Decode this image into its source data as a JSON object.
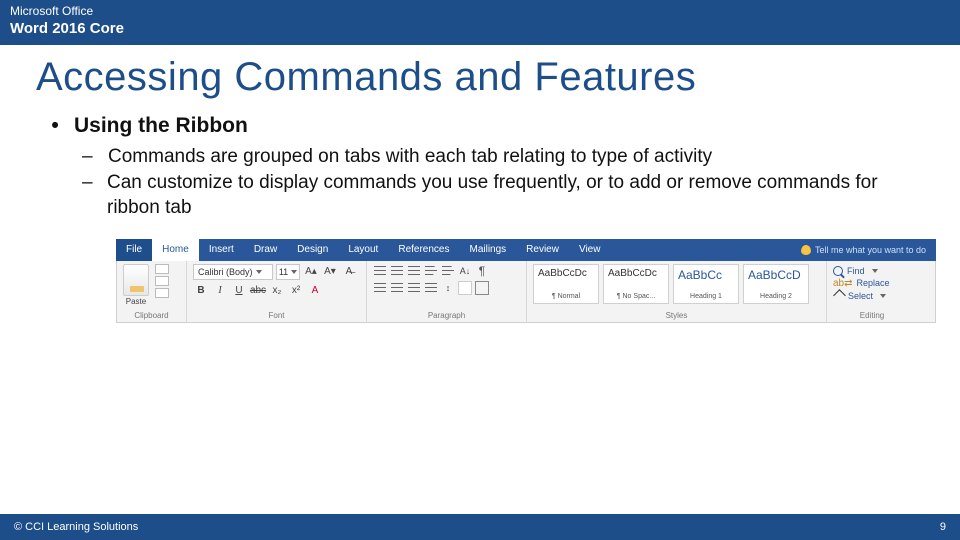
{
  "header": {
    "line1": "Microsoft Office",
    "line2": "Word 2016 Core"
  },
  "title": "Accessing Commands and Features",
  "bullets": {
    "main": "Using the Ribbon",
    "subs": [
      "Commands are grouped on tabs with each tab relating to type of activity",
      "Can customize to display commands you use frequently, or to add or remove commands for ribbon tab"
    ]
  },
  "ribbon": {
    "tabs": [
      "File",
      "Home",
      "Insert",
      "Draw",
      "Design",
      "Layout",
      "References",
      "Mailings",
      "Review",
      "View"
    ],
    "active_index": 1,
    "tellme": "Tell me what you want to do",
    "groups": {
      "clipboard": {
        "label": "Clipboard",
        "paste": "Paste"
      },
      "font": {
        "label": "Font",
        "fontname": "Calibri (Body)",
        "fontsize": "11",
        "row2": [
          "B",
          "I",
          "U",
          "abc",
          "x₂",
          "x²",
          "A"
        ]
      },
      "paragraph": {
        "label": "Paragraph",
        "pilcrow": "¶"
      },
      "styles": {
        "label": "Styles",
        "tiles": [
          {
            "sample": "AaBbCcDc",
            "name": "¶ Normal"
          },
          {
            "sample": "AaBbCcDc",
            "name": "¶ No Spac..."
          },
          {
            "sample": "AaBbCc",
            "name": "Heading 1",
            "blue": true
          },
          {
            "sample": "AaBbCcD",
            "name": "Heading 2",
            "blue": true
          }
        ]
      },
      "editing": {
        "label": "Editing",
        "find": "Find",
        "replace": "Replace",
        "select": "Select"
      }
    }
  },
  "footer": {
    "copyright": "© CCI Learning Solutions",
    "page": "9"
  }
}
